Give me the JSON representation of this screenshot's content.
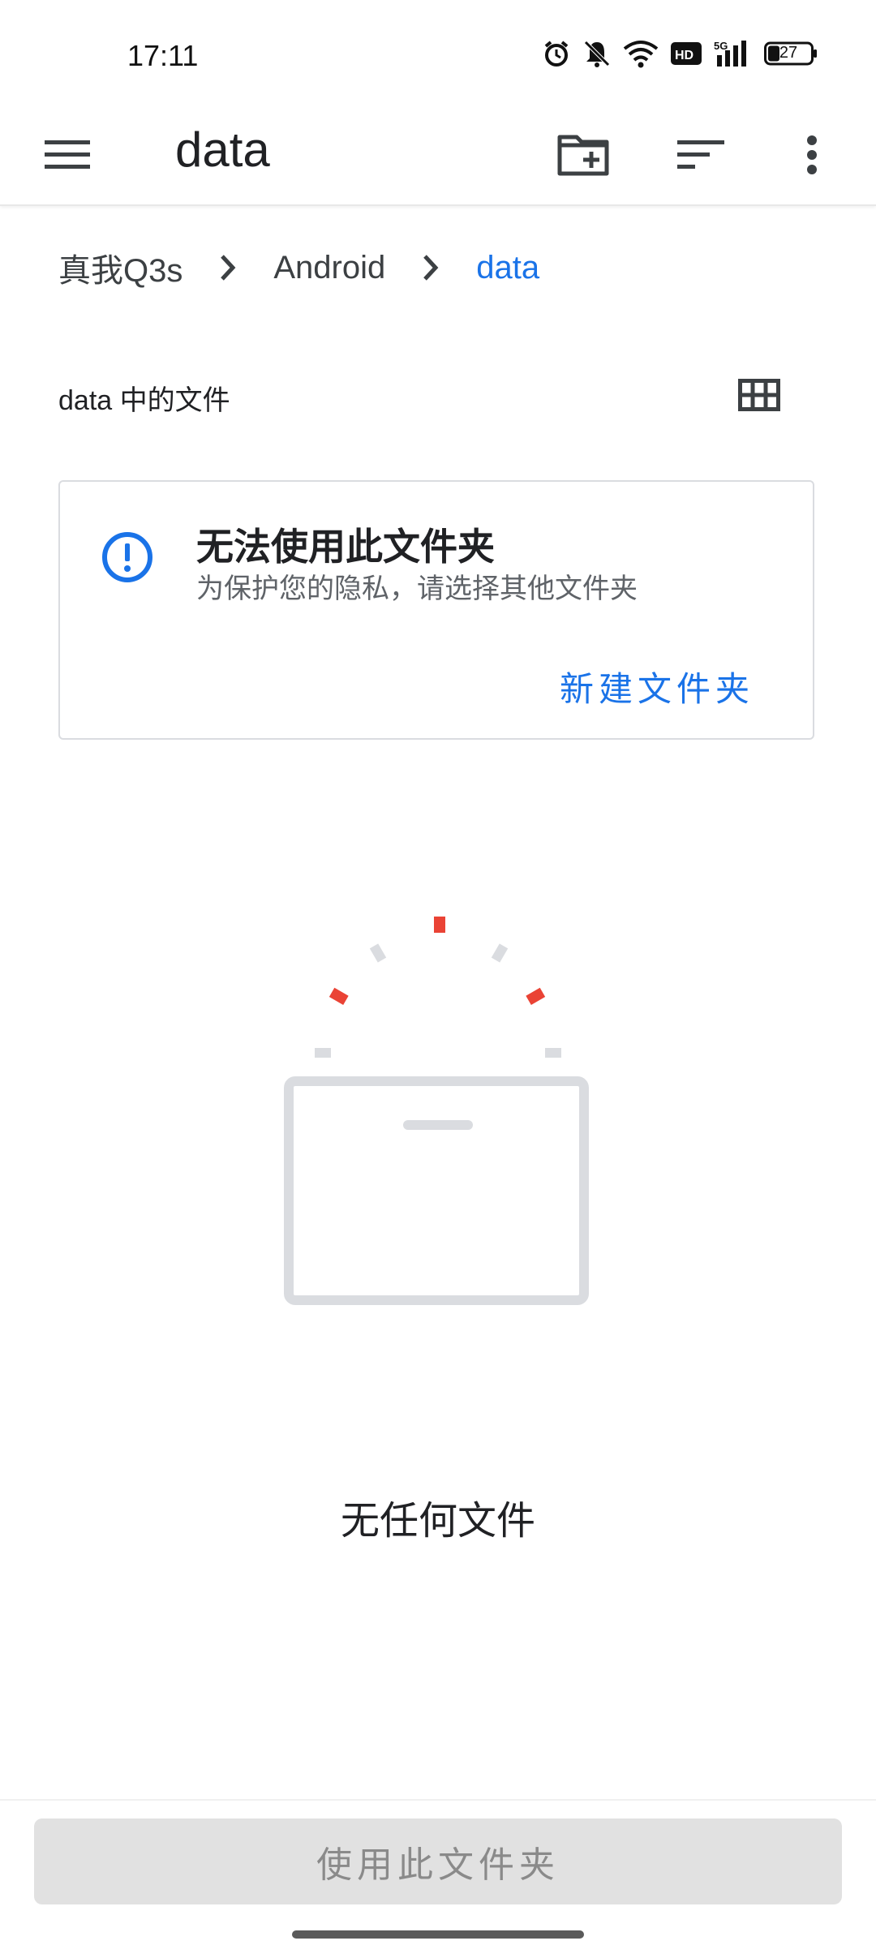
{
  "status_bar": {
    "time": "17:11",
    "battery": "27",
    "icons": [
      "alarm-icon",
      "mute-icon",
      "wifi-icon",
      "hd-icon",
      "5g-signal-icon",
      "battery-icon"
    ]
  },
  "app_bar": {
    "title": "data",
    "icons": [
      "menu-icon",
      "new-folder-icon",
      "sort-icon",
      "more-vert-icon"
    ]
  },
  "breadcrumb": {
    "items": [
      {
        "label": "真我Q3s"
      },
      {
        "label": "Android"
      },
      {
        "label": "data"
      }
    ]
  },
  "section": {
    "label": "data 中的文件",
    "view_toggle_icon": "grid-view-icon"
  },
  "notice_card": {
    "icon": "alert-circle-icon",
    "title": "无法使用此文件夹",
    "subtitle": "为保护您的隐私，请选择其他文件夹",
    "action_label": "新建文件夹"
  },
  "empty_state": {
    "illustration": "empty-box-icon",
    "message": "无任何文件"
  },
  "bottom": {
    "use_folder_label": "使用此文件夹"
  },
  "colors": {
    "accent": "#1a73e8",
    "illustration_red": "#ea4335",
    "illustration_grey": "#dadce0",
    "disabled_button": "#e1e1e1"
  }
}
